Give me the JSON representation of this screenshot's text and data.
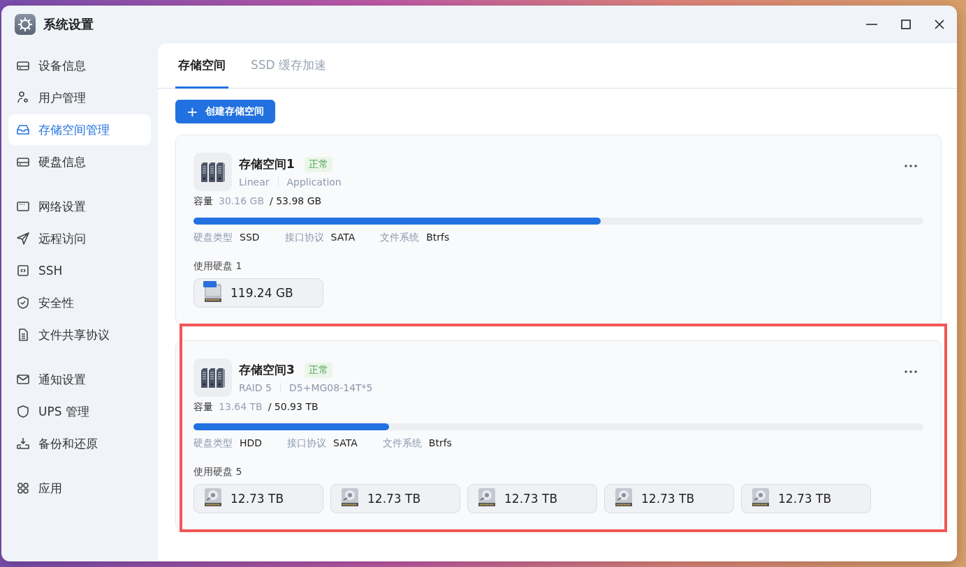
{
  "window": {
    "title": "系统设置"
  },
  "sidebar": {
    "groups": [
      {
        "items": [
          {
            "label": "设备信息",
            "selected": false
          },
          {
            "label": "用户管理",
            "selected": false
          },
          {
            "label": "存储空间管理",
            "selected": true
          },
          {
            "label": "硬盘信息",
            "selected": false
          }
        ]
      },
      {
        "items": [
          {
            "label": "网络设置",
            "selected": false
          },
          {
            "label": "远程访问",
            "selected": false
          },
          {
            "label": "SSH",
            "selected": false
          },
          {
            "label": "安全性",
            "selected": false
          },
          {
            "label": "文件共享协议",
            "selected": false
          }
        ]
      },
      {
        "items": [
          {
            "label": "通知设置",
            "selected": false
          },
          {
            "label": "UPS 管理",
            "selected": false
          },
          {
            "label": "备份和还原",
            "selected": false
          }
        ]
      },
      {
        "items": [
          {
            "label": "应用",
            "selected": false
          }
        ]
      }
    ]
  },
  "tabs": [
    {
      "label": "存储空间",
      "selected": true
    },
    {
      "label": "SSD 缓存加速",
      "selected": false
    }
  ],
  "create_button": {
    "icon": "+",
    "label": "创建存储空间"
  },
  "storage_pools": [
    {
      "name": "存储空间1",
      "status": "正常",
      "tags": [
        "Linear",
        "Application"
      ],
      "capacity_label": "容量",
      "used": "30.16 GB",
      "total": "/ 53.98 GB",
      "level": 0.558,
      "specs": [
        {
          "label": "硬盘类型",
          "value": "SSD"
        },
        {
          "label": "接口协议",
          "value": "SATA"
        },
        {
          "label": "文件系统",
          "value": "Btrfs"
        }
      ],
      "disks_label": "使用硬盘 1",
      "disks": [
        {
          "kind": "ssd",
          "size": "119.24 GB"
        }
      ],
      "highlighted": false
    },
    {
      "name": "存储空间3",
      "status": "正常",
      "tags": [
        "RAID 5",
        "D5+MG08-14T*5"
      ],
      "capacity_label": "容量",
      "used": "13.64 TB",
      "total": "/ 50.93 TB",
      "level": 0.268,
      "specs": [
        {
          "label": "硬盘类型",
          "value": "HDD"
        },
        {
          "label": "接口协议",
          "value": "SATA"
        },
        {
          "label": "文件系统",
          "value": "Btrfs"
        }
      ],
      "disks_label": "使用硬盘 5",
      "disks": [
        {
          "kind": "hdd",
          "size": "12.73 TB"
        },
        {
          "kind": "hdd",
          "size": "12.73 TB"
        },
        {
          "kind": "hdd",
          "size": "12.73 TB"
        },
        {
          "kind": "hdd",
          "size": "12.73 TB"
        },
        {
          "kind": "hdd",
          "size": "12.73 TB"
        }
      ],
      "highlighted": true
    }
  ]
}
